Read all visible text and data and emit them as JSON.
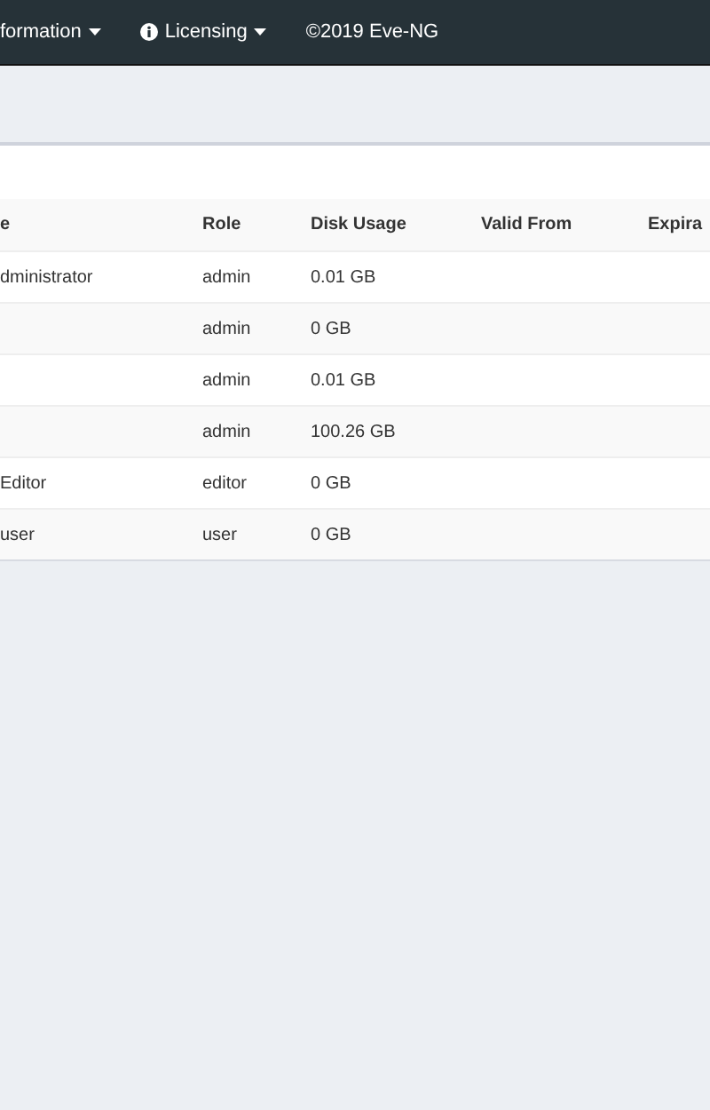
{
  "navbar": {
    "items": [
      {
        "label": "formation",
        "icon": false,
        "dropdown": true
      },
      {
        "label": "Licensing",
        "icon": true,
        "dropdown": true
      },
      {
        "label": "©2019 Eve-NG",
        "icon": false,
        "dropdown": false
      }
    ]
  },
  "table": {
    "columns": [
      "e",
      "Role",
      "Disk Usage",
      "Valid From",
      "Expira"
    ],
    "rows": [
      {
        "name": "dministrator",
        "role": "admin",
        "disk": "0.01 GB"
      },
      {
        "role": "admin",
        "disk": "0 GB"
      },
      {
        "role": "admin",
        "disk": "0.01 GB"
      },
      {
        "role": "admin",
        "disk": "100.26 GB"
      },
      {
        "name": "Editor",
        "role": "editor",
        "disk": "0 GB"
      },
      {
        "name": "user",
        "role": "user",
        "disk": "0 GB"
      }
    ]
  }
}
